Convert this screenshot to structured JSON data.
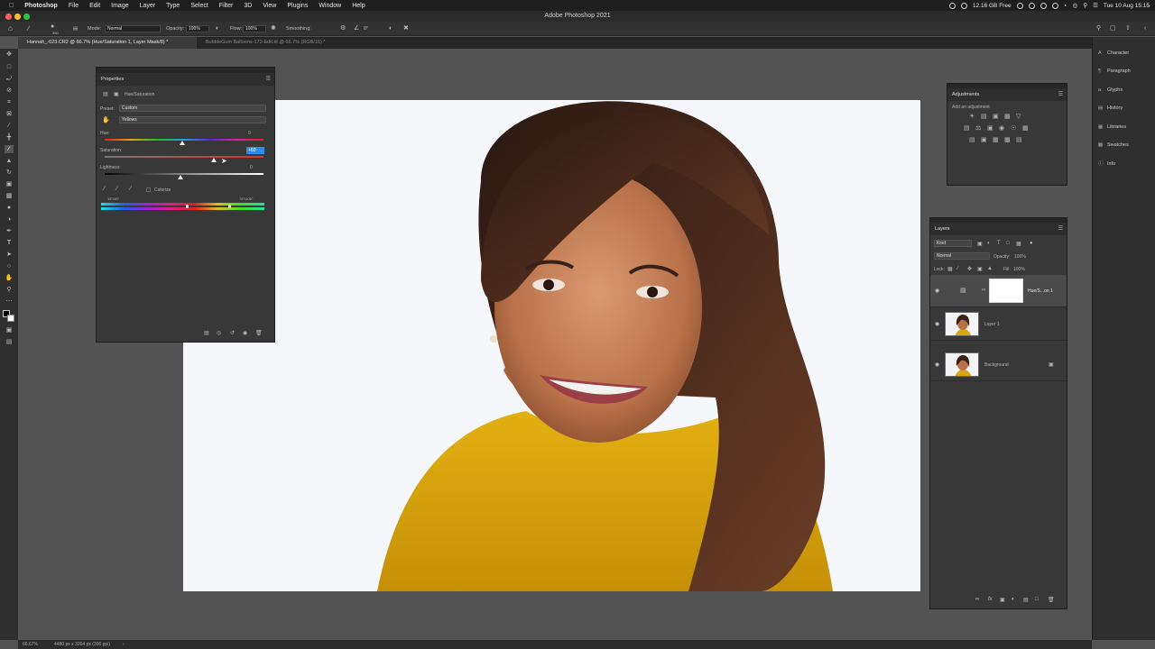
{
  "menubar": {
    "app_name": "Photoshop",
    "items": [
      "File",
      "Edit",
      "Image",
      "Layer",
      "Type",
      "Select",
      "Filter",
      "3D",
      "View",
      "Plugins",
      "Window",
      "Help"
    ],
    "disk_free": "12.16 GB Free",
    "clock": "Tue 10 Aug  15:15"
  },
  "window": {
    "title": "Adobe Photoshop 2021"
  },
  "options_bar": {
    "brush_size": "350",
    "mode_label": "Mode:",
    "mode_value": "Normal",
    "opacity_label": "Opacity:",
    "opacity_value": "100%",
    "flow_label": "Flow:",
    "flow_value": "100%",
    "smoothing_label": "Smoothing:",
    "angle_value": "0°"
  },
  "tabs": [
    {
      "label": "Hannah_-023.CR2 @ 66.7% (Hue/Saturation 1, Layer Mask/8) *"
    },
    {
      "label": "BubbleGum Balloons-172-Edit.tif @ 66.7% (RGB/16) *"
    }
  ],
  "properties": {
    "title": "Properties",
    "subtitle": "Hue/Saturation",
    "preset_label": "Preset:",
    "preset_value": "Custom",
    "channel_value": "Yellows",
    "hue_label": "Hue:",
    "hue_value": "0",
    "saturation_label": "Saturation:",
    "saturation_value": "+60",
    "lightness_label": "Lightness:",
    "lightness_value": "0",
    "colorize_label": "Colorize",
    "range_left": "15°/45°",
    "range_right": "75°\\105°"
  },
  "adjustments": {
    "title": "Adjustments",
    "hint": "Add an adjustment"
  },
  "layers": {
    "title": "Layers",
    "kind_value": "Kind",
    "blend_value": "Normal",
    "opacity_label": "Opacity:",
    "opacity_value": "100%",
    "lock_label": "Lock:",
    "fill_label": "Fill:",
    "fill_value": "100%",
    "rows": [
      {
        "name": "Hue/S...on 1"
      },
      {
        "name": "Layer 1"
      },
      {
        "name": "Background"
      }
    ]
  },
  "dock": {
    "items": [
      "Character",
      "Paragraph",
      "Glyphs",
      "History",
      "Libraries",
      "Swatches",
      "Info"
    ]
  },
  "status": {
    "zoom": "66.67%",
    "doc_size": "4480 px x 3264 px (300 ppi)"
  },
  "colors": {
    "accent": "#2d8ceb",
    "panel_bg": "#383838",
    "canvas_bg": "#535353",
    "sweater": "#d9a611"
  }
}
